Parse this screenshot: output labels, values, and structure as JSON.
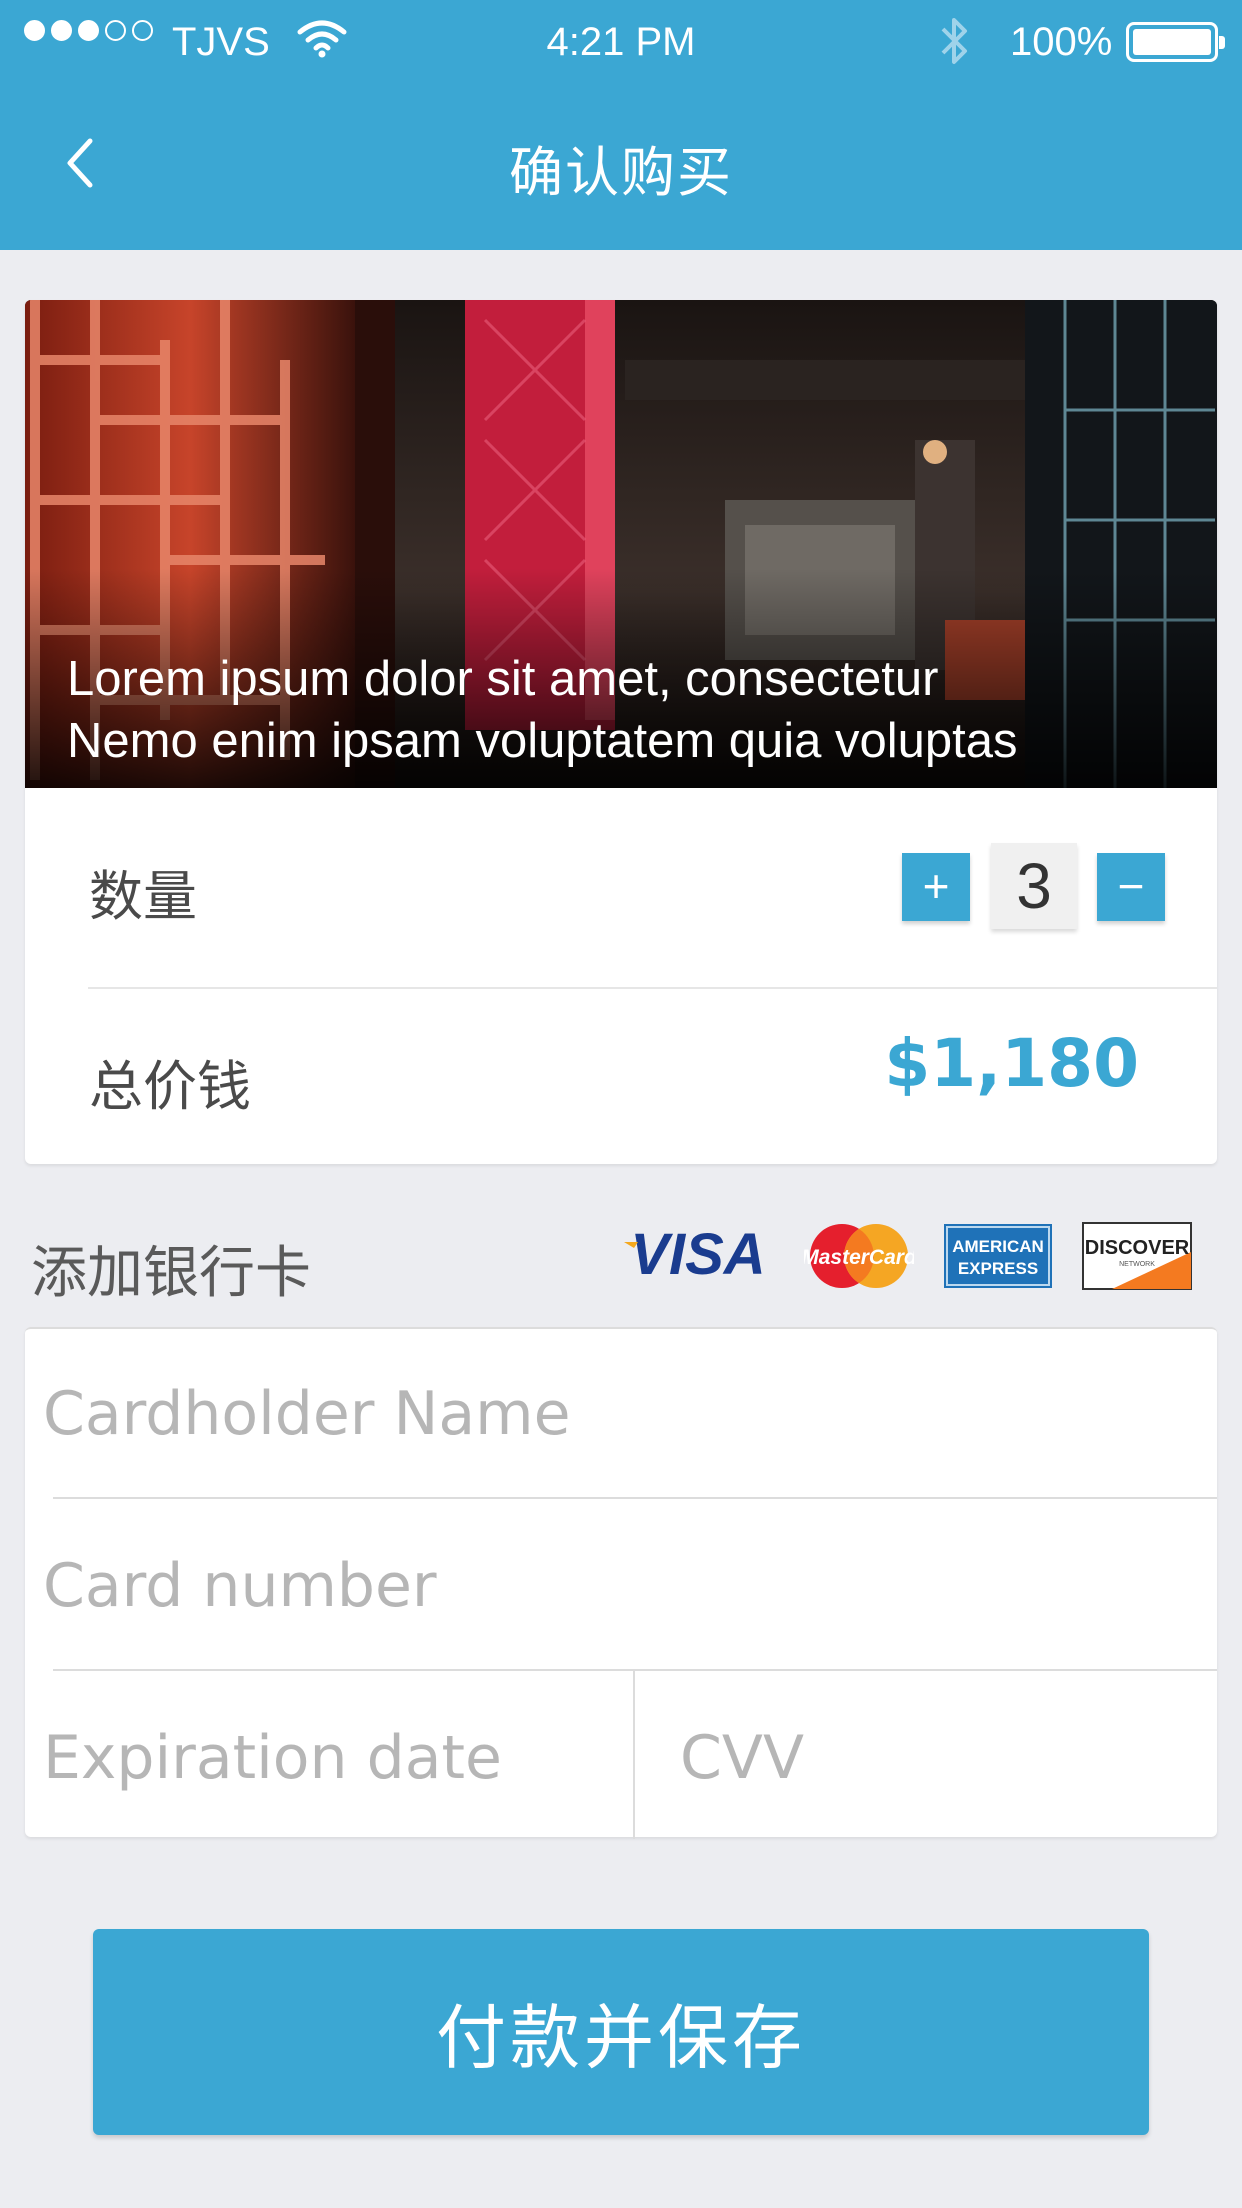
{
  "status_bar": {
    "carrier": "TJVS",
    "time": "4:21 PM",
    "battery": "100%",
    "signal_bars_filled": 3,
    "signal_bars_total": 5
  },
  "nav": {
    "title": "确认购买",
    "back_icon": "chevron-left-icon"
  },
  "product": {
    "caption_line1": "Lorem ipsum dolor sit amet, consectetur",
    "caption_line2": "Nemo enim ipsam voluptatem quia voluptas"
  },
  "quantity": {
    "label": "数量",
    "plus": "+",
    "value": "3",
    "minus": "−"
  },
  "total": {
    "label": "总价钱",
    "value": "$1,180"
  },
  "payment": {
    "heading": "添加银行卡",
    "logos": {
      "visa": "VISA",
      "mastercard": "MasterCard",
      "amex_line1": "AMERICAN",
      "amex_line2": "EXPRESS",
      "discover": "DISCOVER",
      "discover_sub": "NETWORK"
    },
    "cardholder_placeholder": "Cardholder Name",
    "card_number_placeholder": "Card number",
    "expiration_placeholder": "Expiration date",
    "cvv_placeholder": "CVV"
  },
  "submit": {
    "label": "付款并保存"
  },
  "colors": {
    "accent": "#3ba7d3",
    "background": "#ecedf1"
  }
}
